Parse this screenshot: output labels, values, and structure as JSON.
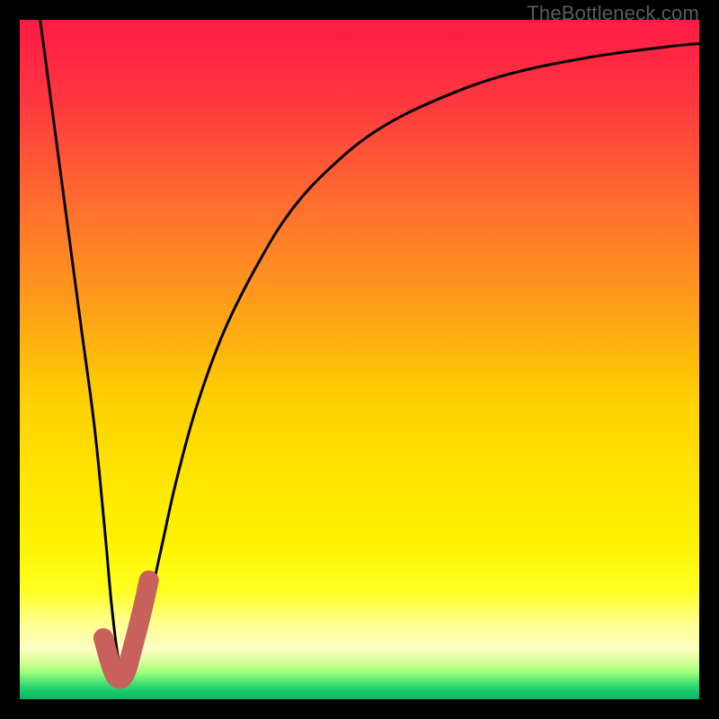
{
  "watermark": "TheBottleneck.com",
  "colors": {
    "frame": "#000000",
    "curve": "#000000",
    "hook": "#c8605b",
    "gradient_stops": [
      {
        "o": 0.0,
        "c": "#ff1a46"
      },
      {
        "o": 0.12,
        "c": "#ff3740"
      },
      {
        "o": 0.26,
        "c": "#ff6a30"
      },
      {
        "o": 0.42,
        "c": "#ff9e1a"
      },
      {
        "o": 0.56,
        "c": "#ffd000"
      },
      {
        "o": 0.68,
        "c": "#ffe600"
      },
      {
        "o": 0.77,
        "c": "#fff400"
      },
      {
        "o": 0.84,
        "c": "#ffff20"
      },
      {
        "o": 0.88,
        "c": "#ffff80"
      },
      {
        "o": 0.923,
        "c": "#ffffc4"
      },
      {
        "o": 0.945,
        "c": "#d8ff9a"
      },
      {
        "o": 0.96,
        "c": "#a0ff7a"
      },
      {
        "o": 0.975,
        "c": "#4be576"
      },
      {
        "o": 0.988,
        "c": "#16c96b"
      },
      {
        "o": 1.0,
        "c": "#08b763"
      }
    ]
  },
  "chart_data": {
    "type": "line",
    "title": "",
    "xlabel": "",
    "ylabel": "",
    "xlim": [
      0,
      100
    ],
    "ylim": [
      0,
      100
    ],
    "grid": false,
    "series": [
      {
        "name": "bottleneck-curve",
        "x": [
          3,
          5,
          7,
          9,
          11,
          12.5,
          13.5,
          14.5,
          15.5,
          17,
          19,
          21,
          23,
          26,
          30,
          35,
          40,
          46,
          53,
          62,
          72,
          84,
          95,
          100
        ],
        "y": [
          100,
          85,
          70,
          55,
          40,
          25,
          14,
          6,
          3.5,
          6,
          14,
          23,
          32,
          43,
          54,
          64,
          72,
          78.5,
          84,
          88.5,
          92,
          94.5,
          96,
          96.5
        ]
      }
    ],
    "annotations": [
      {
        "name": "valley-hook",
        "shape": "J",
        "x": [
          12.3,
          13.6,
          14.6,
          15.6,
          16.6,
          18.0,
          19.0
        ],
        "y": [
          9.0,
          4.5,
          3.0,
          4.0,
          7.5,
          13.0,
          17.5
        ]
      }
    ]
  }
}
